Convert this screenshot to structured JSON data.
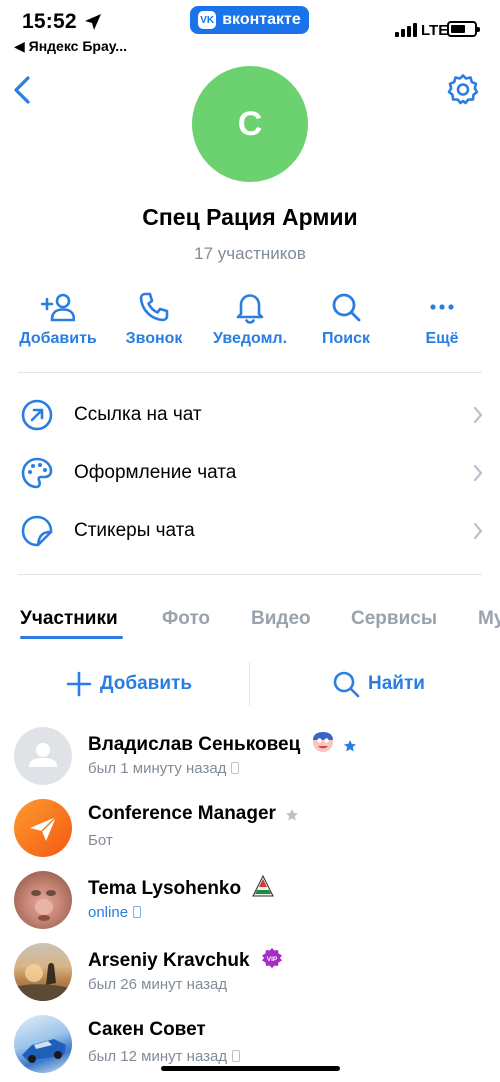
{
  "status_bar": {
    "time": "15:52",
    "back_app": "◀ Яндекс Брау...",
    "vk_label": "вконтакте",
    "network": "LTE"
  },
  "header": {
    "avatar_letter": "С",
    "avatar_color": "#6cd16f",
    "title": "Спец Рация Армии",
    "subtitle": "17 участников"
  },
  "actions": [
    {
      "label": "Добавить",
      "icon": "add-user-icon"
    },
    {
      "label": "Звонок",
      "icon": "phone-icon"
    },
    {
      "label": "Уведомл.",
      "icon": "bell-icon"
    },
    {
      "label": "Поиск",
      "icon": "search-icon"
    },
    {
      "label": "Ещё",
      "icon": "more-icon"
    }
  ],
  "menu": [
    {
      "label": "Ссылка на чат",
      "icon": "link-arrow-icon"
    },
    {
      "label": "Оформление чата",
      "icon": "palette-icon"
    },
    {
      "label": "Стикеры чата",
      "icon": "sticker-icon"
    }
  ],
  "tabs": [
    {
      "label": "Участники",
      "active": true
    },
    {
      "label": "Фото"
    },
    {
      "label": "Видео"
    },
    {
      "label": "Сервисы"
    },
    {
      "label": "Му"
    }
  ],
  "members_toolbar": {
    "add_label": "Добавить",
    "find_label": "Найти"
  },
  "members": [
    {
      "name": "Владислав Сеньковец",
      "status": "был 1 минуту назад",
      "avatar": "default-avatar",
      "badges": [
        "mask-emoji",
        "blue-star-icon"
      ],
      "device": "phone"
    },
    {
      "name": "Conference Manager",
      "status": "Бот",
      "avatar": "paper-plane-avatar",
      "badges": [
        "gray-star-icon"
      ]
    },
    {
      "name": "Tema Lysohenko",
      "status": "online",
      "avatar": "photo-face",
      "badges": [
        "football-club-logo"
      ],
      "device": "phone",
      "online": true
    },
    {
      "name": "Arseniy Kravchuk",
      "status": "был 26 минут назад",
      "avatar": "photo-sunset",
      "badges": [
        "vip-badge-icon"
      ]
    },
    {
      "name": "Сакен Совет",
      "status": "был 12 минут назад",
      "avatar": "photo-car",
      "badges": [],
      "device": "phone"
    }
  ],
  "colors": {
    "accent": "#2a7de1",
    "secondary_text": "#818c99",
    "tab_inactive": "#99a2ad"
  }
}
